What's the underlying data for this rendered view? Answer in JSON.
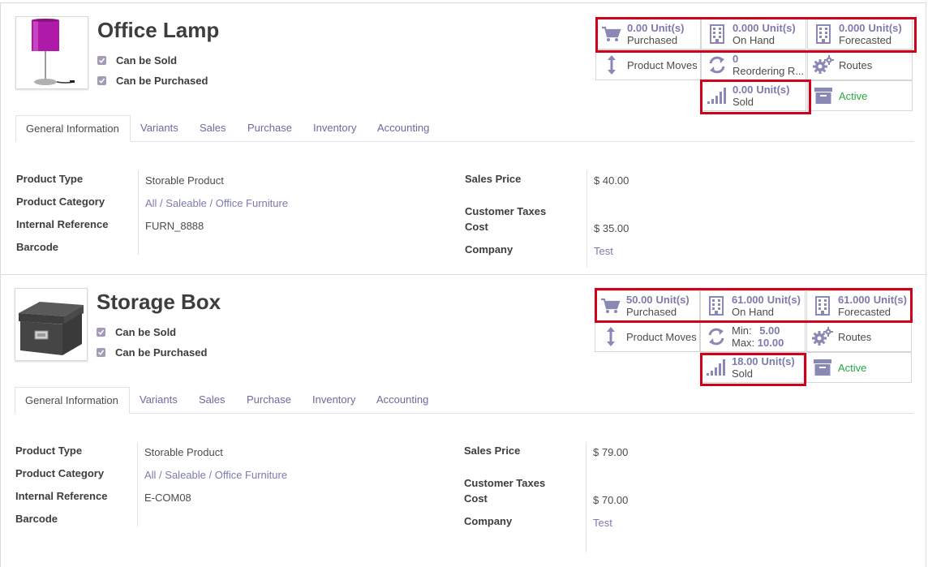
{
  "tabs": [
    "General Information",
    "Variants",
    "Sales",
    "Purchase",
    "Inventory",
    "Accounting"
  ],
  "field_labels": {
    "product_type": "Product Type",
    "product_category": "Product Category",
    "internal_reference": "Internal Reference",
    "barcode": "Barcode",
    "sales_price": "Sales Price",
    "customer_taxes": "Customer Taxes",
    "cost": "Cost",
    "company": "Company"
  },
  "products": [
    {
      "name": "Office Lamp",
      "can_be_sold": "Can be Sold",
      "can_be_purchased": "Can be Purchased",
      "stats": {
        "purchased": {
          "value": "0.00",
          "unit": "Unit(s)",
          "label": "Purchased"
        },
        "on_hand": {
          "value": "0.000",
          "unit": "Unit(s)",
          "label": "On Hand"
        },
        "forecasted": {
          "value": "0.000",
          "unit": "Unit(s)",
          "label": "Forecasted"
        },
        "product_moves": "Product Moves",
        "reordering_value": "0",
        "reordering_label": "Reordering R...",
        "routes": "Routes",
        "sold": {
          "value": "0.00",
          "unit": "Unit(s)",
          "label": "Sold"
        },
        "active": "Active"
      },
      "fields": {
        "product_type": "Storable Product",
        "product_category": "All / Saleable / Office Furniture",
        "internal_reference": "FURN_8888",
        "sales_price": "$ 40.00",
        "cost": "$ 35.00",
        "company": "Test"
      }
    },
    {
      "name": "Storage Box",
      "can_be_sold": "Can be Sold",
      "can_be_purchased": "Can be Purchased",
      "stats": {
        "purchased": {
          "value": "50.00",
          "unit": "Unit(s)",
          "label": "Purchased"
        },
        "on_hand": {
          "value": "61.000",
          "unit": "Unit(s)",
          "label": "On Hand"
        },
        "forecasted": {
          "value": "61.000",
          "unit": "Unit(s)",
          "label": "Forecasted"
        },
        "product_moves": "Product Moves",
        "min_label": "Min:",
        "min_value": "5.00",
        "max_label": "Max:",
        "max_value": "10.00",
        "routes": "Routes",
        "sold": {
          "value": "18.00",
          "unit": "Unit(s)",
          "label": "Sold"
        },
        "active": "Active"
      },
      "fields": {
        "product_type": "Storable Product",
        "product_category": "All / Saleable / Office Furniture",
        "internal_reference": "E-COM08",
        "sales_price": "$ 79.00",
        "cost": "$ 70.00",
        "company": "Test"
      }
    }
  ],
  "colors": {
    "accent": "#7c7bad",
    "highlight_box": "#d0021b",
    "active": "#28a745",
    "icon": "#8a88b5"
  }
}
